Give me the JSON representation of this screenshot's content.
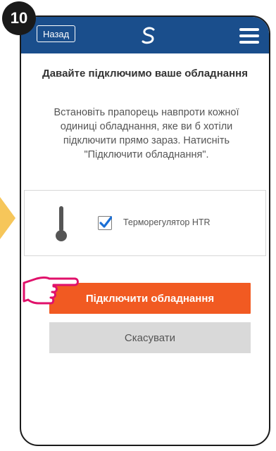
{
  "step_number": "10",
  "header": {
    "back_label": "Назад",
    "logo_icon": "salus-logo-icon",
    "menu_icon": "hamburger-menu-icon"
  },
  "main": {
    "title": "Давайте підключимо ваше обладнання",
    "description": "Встановіть прапорець навпроти кожної одиниці обладнання, яке ви б хотіли підключити прямо зараз. Натисніть \"Підключити обладнання\".",
    "devices": [
      {
        "label": "Терморегулятор HTR",
        "icon": "thermometer-icon",
        "checked": true
      }
    ],
    "connect_label": "Підключити обладнання",
    "cancel_label": "Скасувати"
  },
  "colors": {
    "header": "#1a4e8c",
    "primary_button": "#f15a22",
    "secondary_button": "#d9d9d9",
    "checkbox_check": "#1a6fd6",
    "pointer_arrow": "#f6c65a",
    "hand_outline": "#e0106a"
  }
}
